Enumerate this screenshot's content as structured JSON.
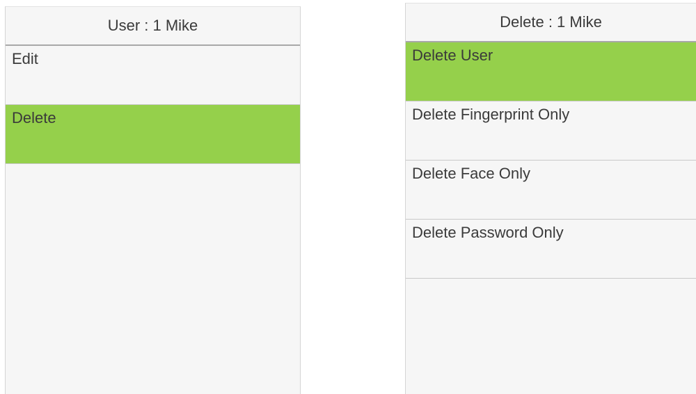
{
  "left_screen": {
    "header_title": "User : 1 Mike",
    "items": [
      {
        "label": "Edit",
        "selected": false
      },
      {
        "label": "Delete",
        "selected": true
      }
    ]
  },
  "right_screen": {
    "header_title": "Delete : 1 Mike",
    "items": [
      {
        "label": "Delete User",
        "selected": true
      },
      {
        "label": "Delete Fingerprint Only",
        "selected": false
      },
      {
        "label": "Delete Face Only",
        "selected": false
      },
      {
        "label": "Delete Password Only",
        "selected": false
      }
    ]
  },
  "colors": {
    "selected_bg": "#95d04b",
    "screen_bg": "#f6f6f6",
    "text": "#3a3a3a"
  }
}
